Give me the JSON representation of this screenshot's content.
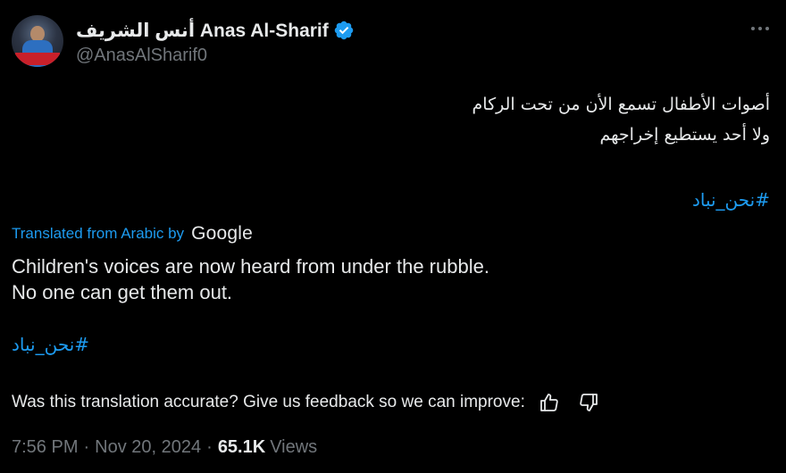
{
  "post": {
    "author_name": "أنس الشريف Anas Al-Sharif",
    "author_handle": "@AnasAlSharif0",
    "arabic_lines": [
      "أصوات الأطفال تسمع الأن من تحت الركام",
      "ولا أحد يستطيع إخراجهم"
    ],
    "arabic_hashtag": "#نحن_نباد",
    "translated_label": "Translated from Arabic by",
    "translator_name": "Google",
    "english_lines": [
      "Children's voices are now heard from under the rubble.",
      "No one can get them out."
    ],
    "english_hashtag": "#نحن_نباد",
    "feedback_prompt": "Was this translation accurate? Give us feedback so we can improve:",
    "time": "7:56 PM",
    "separator": "·",
    "date": "Nov 20, 2024",
    "views_count": "65.1K",
    "views_label": "Views"
  },
  "icons": {
    "verified": "verified-badge-icon",
    "more": "more-options-icon",
    "thumbs_up": "thumbs-up-icon",
    "thumbs_down": "thumbs-down-icon"
  },
  "colors": {
    "background": "#000000",
    "text": "#e7e9ea",
    "secondary": "#71767b",
    "accent": "#1d9bf0"
  }
}
